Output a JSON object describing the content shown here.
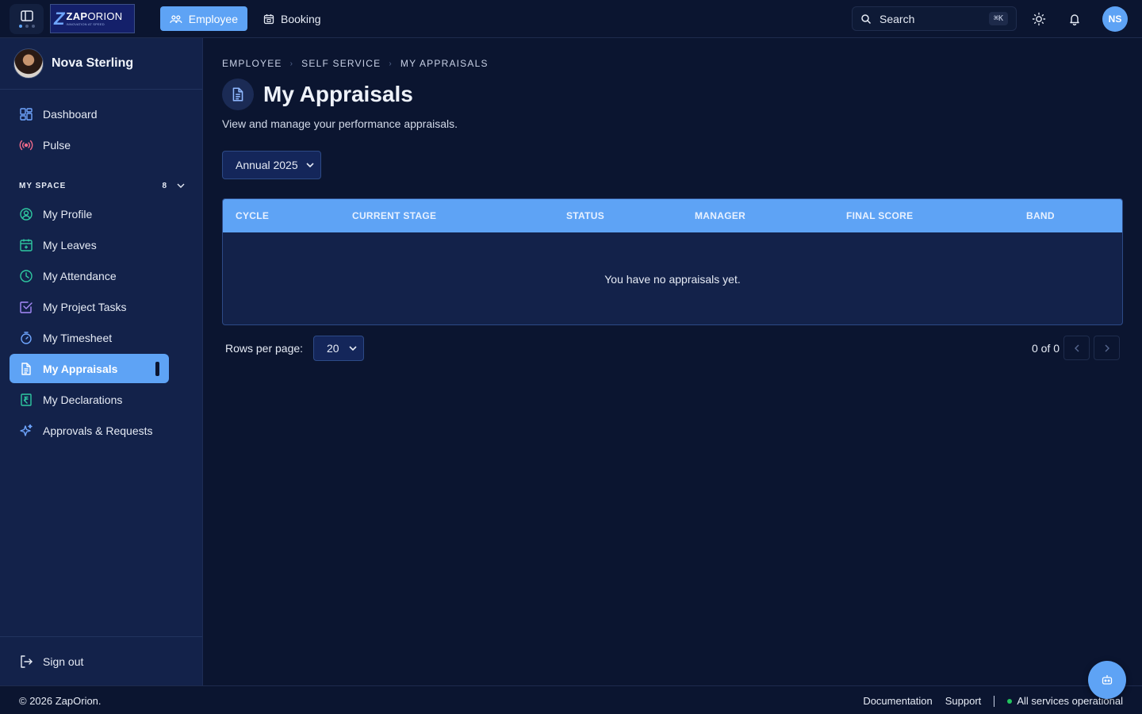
{
  "topbar": {
    "logo": {
      "mark": "Z",
      "name_bold": "ZAP",
      "name_rest": "ORION",
      "tagline": "INNOVATION AT SPEED"
    },
    "tabs": [
      {
        "label": "Employee",
        "active": true,
        "icon": "users-icon"
      },
      {
        "label": "Booking",
        "active": false,
        "icon": "calendar-icon"
      }
    ],
    "search": {
      "label": "Search",
      "shortcut": "⌘K"
    },
    "avatar_initials": "NS"
  },
  "sidebar": {
    "user_name": "Nova Sterling",
    "top_items": [
      {
        "label": "Dashboard",
        "icon": "dashboard-icon"
      },
      {
        "label": "Pulse",
        "icon": "broadcast-icon"
      }
    ],
    "section": {
      "title": "MY SPACE",
      "count": "8"
    },
    "items": [
      {
        "label": "My Profile",
        "icon": "user-circle-icon"
      },
      {
        "label": "My Leaves",
        "icon": "calendar-plus-icon"
      },
      {
        "label": "My Attendance",
        "icon": "clock-icon"
      },
      {
        "label": "My Project Tasks",
        "icon": "checkbox-icon"
      },
      {
        "label": "My Timesheet",
        "icon": "stopwatch-icon"
      },
      {
        "label": "My Appraisals",
        "icon": "document-icon",
        "active": true
      },
      {
        "label": "My Declarations",
        "icon": "rupee-document-icon"
      },
      {
        "label": "Approvals & Requests",
        "icon": "sparkles-icon"
      }
    ],
    "sign_out": "Sign out"
  },
  "main": {
    "breadcrumb": [
      "EMPLOYEE",
      "SELF SERVICE",
      "MY APPRAISALS"
    ],
    "title": "My Appraisals",
    "subtitle": "View and manage your performance appraisals.",
    "cycle_select": "Annual 2025",
    "table": {
      "columns": [
        "CYCLE",
        "CURRENT STAGE",
        "STATUS",
        "MANAGER",
        "FINAL SCORE",
        "BAND"
      ],
      "empty_message": "You have no appraisals yet."
    },
    "pagination": {
      "rows_label": "Rows per page:",
      "rows_value": "20",
      "info": "0 of 0"
    }
  },
  "footer": {
    "copyright": "© 2026 ZapOrion.",
    "links": [
      "Documentation",
      "Support"
    ],
    "status": "All services operational"
  },
  "colors": {
    "accent": "#5ea3f5",
    "background": "#0b1530",
    "sidebar": "#13224a",
    "status_ok": "#22c55e"
  }
}
